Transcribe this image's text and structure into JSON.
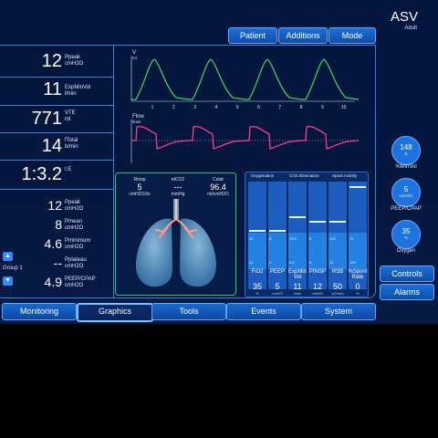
{
  "mode": {
    "title": "ASV",
    "subtitle": "Adult"
  },
  "top_buttons": [
    "Patient",
    "Additions",
    "Mode"
  ],
  "readouts": [
    {
      "value": "12",
      "label": "Ppeak\ncmH2O"
    },
    {
      "value": "11",
      "label": "ExpMinVol\nl/min"
    },
    {
      "value": "771",
      "label": "VTE\nml"
    },
    {
      "value": "14",
      "label": "fTotal\nb/min"
    },
    {
      "value": "1:3.2",
      "label": "I:E"
    }
  ],
  "group_readouts": [
    {
      "value": "12",
      "label": "Ppeak\ncmH2O"
    },
    {
      "value": "8",
      "label": "Pmean\ncmH2O"
    },
    {
      "value": "4.6",
      "label": "Pminimum\ncmH2O"
    },
    {
      "value": "--",
      "label": "Pplateau\ncmH2O"
    },
    {
      "value": "4.9",
      "label": "PEEP/CPAP\ncmH2O"
    }
  ],
  "group": {
    "label": "Group 1",
    "up_icon": "triangle-up-icon",
    "down_icon": "triangle-down-icon"
  },
  "graphs": {
    "volume": {
      "axis_label": "V",
      "unit": "ml",
      "color": "#3fcf5a",
      "ticks": [
        "1",
        "2",
        "3",
        "4",
        "5",
        "6",
        "7",
        "8",
        "9",
        "10"
      ]
    },
    "flow": {
      "axis_label": "Flow",
      "unit": "l/min",
      "color": "#ff3d8e"
    }
  },
  "lung_panel": {
    "rinsp": {
      "label": "Rinsp",
      "value": "5",
      "unit": "cmH2O/l/s"
    },
    "etco2": {
      "label": "etCO2",
      "value": "---",
      "unit": "mmHg"
    },
    "cstat": {
      "label": "Cstat",
      "value": "96.4",
      "unit": "ml/cmH2O"
    },
    "border_color": "#37c46a"
  },
  "bar_panel": {
    "headers": [
      "Oxygenation",
      "CO2 Elimination",
      "Spont Activity"
    ],
    "bars": [
      {
        "top": "",
        "mid": "40",
        "bottom": "21",
        "level": 0.45
      },
      {
        "top": "",
        "mid": "8",
        "bottom": "0",
        "level": 0.45
      },
      {
        "top": "",
        "mid": "15.5",
        "bottom": "5.5",
        "level": 0.6
      },
      {
        "top": "",
        "mid": "8",
        "bottom": "0",
        "level": 0.55
      },
      {
        "top": "",
        "mid": "100",
        "bottom": "10",
        "level": 0.55
      },
      {
        "top": "",
        "mid": "75",
        "bottom": "100",
        "level": 0.95
      }
    ],
    "cells": [
      {
        "label": "FiO2",
        "value": "35",
        "unit": "%"
      },
      {
        "label": "PEEP",
        "value": "5",
        "unit": "cmH2O"
      },
      {
        "label": "ExpMin\nVol",
        "value": "11",
        "unit": "l/min"
      },
      {
        "label": "PINSP",
        "value": "12",
        "unit": "cmH2O"
      },
      {
        "label": "RSB",
        "value": "50",
        "unit": "1/(l*min)"
      },
      {
        "label": "%Spont\nRate",
        "value": "0",
        "unit": "%"
      }
    ]
  },
  "right_circles": [
    {
      "value": "148",
      "unit": "%",
      "label": "%MinVol"
    },
    {
      "value": "5",
      "unit": "cmH2O",
      "label": "PEEP/CPAP"
    },
    {
      "value": "35",
      "unit": "%",
      "label": "Oxygen"
    }
  ],
  "right_buttons": [
    "Controls",
    "Alarms"
  ],
  "bottom_tabs": [
    {
      "label": "Monitoring",
      "active": false
    },
    {
      "label": "Graphics",
      "active": true
    },
    {
      "label": "Tools",
      "active": false
    },
    {
      "label": "Events",
      "active": false
    },
    {
      "label": "System",
      "active": false
    }
  ],
  "colors": {
    "accent": "#1c6fd6",
    "frame": "#3f7fd6",
    "background": "#04163d"
  }
}
